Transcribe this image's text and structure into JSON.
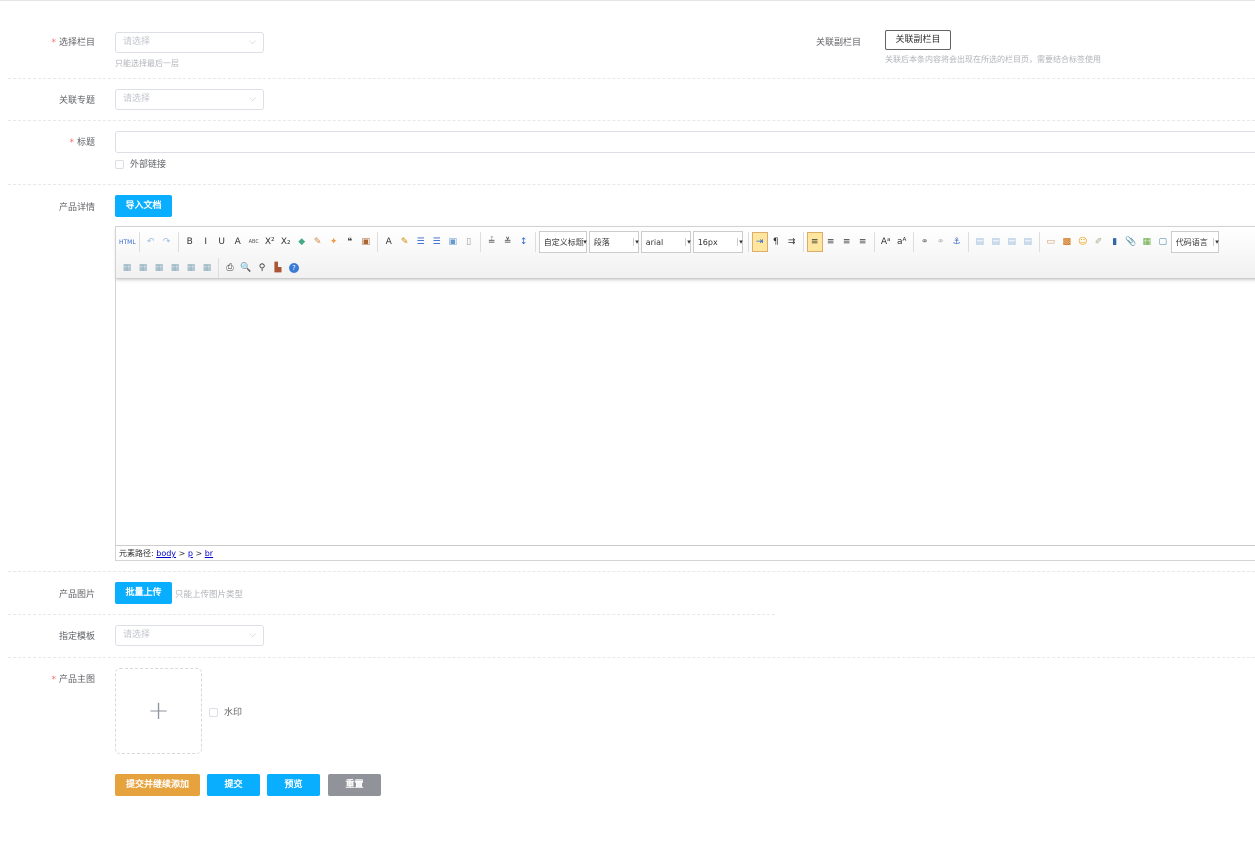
{
  "form": {
    "column": {
      "label": "选择栏目",
      "placeholder": "请选择",
      "hint": "只能选择最后一层"
    },
    "sub_column": {
      "label": "关联副栏目",
      "button": "关联副栏目",
      "hint": "关联后本条内容将会出现在所选的栏目页，需要结合标签使用"
    },
    "topic": {
      "label": "关联专题",
      "placeholder": "请选择"
    },
    "title": {
      "label": "标题",
      "value": "",
      "external_link": "外部链接"
    },
    "detail": {
      "label": "产品详情",
      "import_button": "导入文档"
    },
    "images": {
      "label": "产品图片",
      "upload_button": "批量上传",
      "hint": "只能上传图片类型"
    },
    "template": {
      "label": "指定模板",
      "placeholder": "请选择"
    },
    "main_image": {
      "label": "产品主图",
      "watermark": "水印"
    },
    "actions": {
      "submit_continue": "提交并继续添加",
      "submit": "提交",
      "preview": "预览",
      "reset": "重置"
    },
    "required_mark": "*"
  },
  "editor": {
    "row1": [
      "html",
      "sep",
      "undo",
      "redo",
      "sep",
      "bold",
      "italic",
      "underline",
      "fontborder",
      "strikethrough",
      "superscript",
      "subscript",
      "eraser",
      "formatmatch",
      "autotypeset",
      "blockquote",
      "pasteplain",
      "sep",
      "forecolor",
      "backcolor",
      "orderedlist",
      "unorderedlist",
      "selectall",
      "cleardoc",
      "sep",
      "rowspacingtop",
      "rowspacingbottom",
      "lineheight",
      "sep",
      "combo:customstyle",
      "combo:paragraph",
      "combo:fontfamily",
      "combo:fontsize",
      "sep",
      "ltr",
      "rtl",
      "indent",
      "sep",
      "justifyleft",
      "justifycenter",
      "justifyright",
      "justifyjustify",
      "sep",
      "touppercase",
      "tolowercase",
      "sep",
      "link",
      "unlink",
      "anchor",
      "sep",
      "imagenone",
      "imageleft",
      "imageright",
      "imagecenter",
      "sep",
      "simpleupload",
      "insertimage",
      "emotion",
      "scrawl",
      "insertvideo",
      "attachment",
      "map",
      "insertframe",
      "combo:codelanguage"
    ],
    "row2": [
      "inserttable",
      "deletetable",
      "insertparagraph",
      "insertrow",
      "deleterow",
      "mergecells",
      "sep",
      "print",
      "preview",
      "searchreplace",
      "drafts",
      "help"
    ],
    "combos": {
      "customstyle": "自定义标题",
      "paragraph": "段落",
      "fontfamily": "arial",
      "fontsize": "16px",
      "codelanguage": "代码语言"
    },
    "active": [
      "ltr",
      "justifyleft"
    ],
    "path_label": "元素路径:",
    "path": [
      "body",
      "p",
      "br"
    ]
  },
  "colors": {
    "primary": "#0aaeff",
    "warning": "#e6a23c",
    "info": "#909399"
  }
}
